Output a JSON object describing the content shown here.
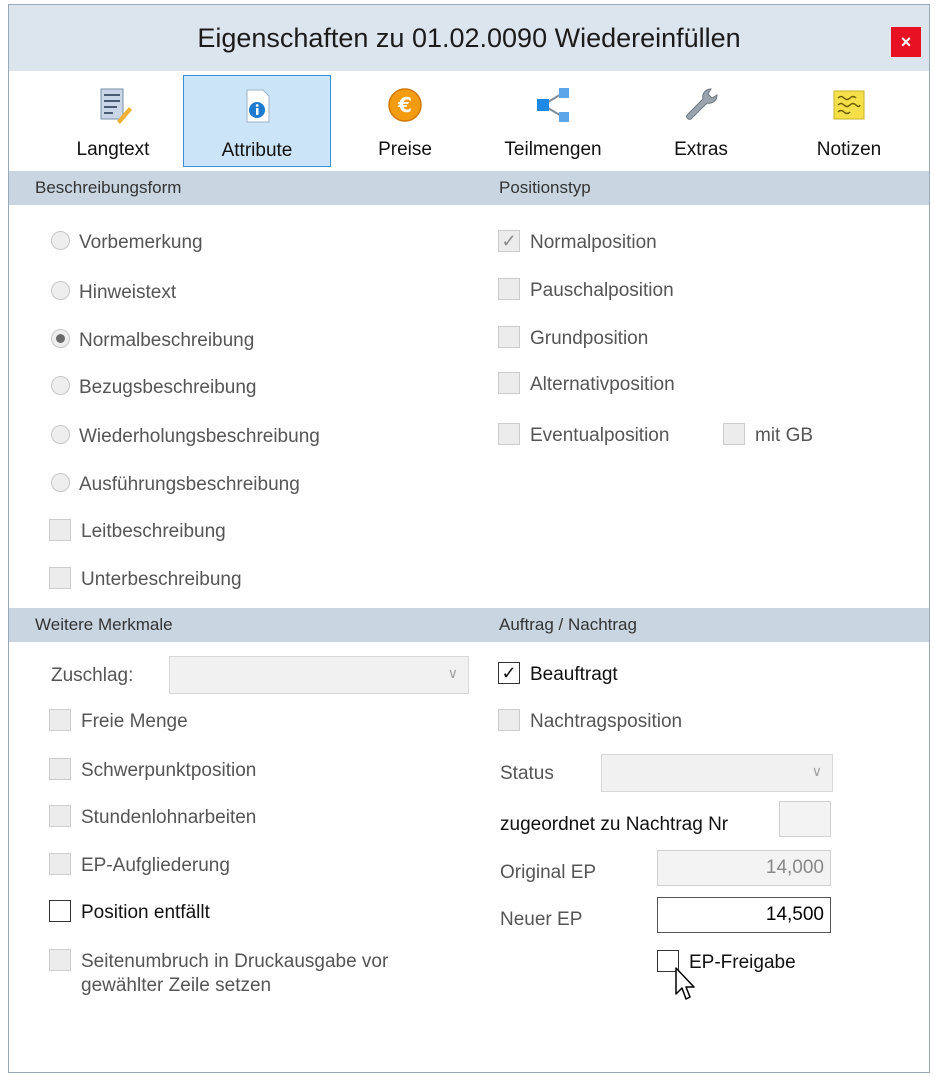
{
  "window": {
    "title": "Eigenschaften zu 01.02.0090 Wiedereinfüllen",
    "close_label": "×"
  },
  "toolbar": {
    "langtext": "Langtext",
    "attribute": "Attribute",
    "preise": "Preise",
    "teilmengen": "Teilmengen",
    "extras": "Extras",
    "notizen": "Notizen"
  },
  "sections": {
    "beschreibungsform": "Beschreibungsform",
    "positionstyp": "Positionstyp",
    "weitere_merkmale": "Weitere Merkmale",
    "auftrag_nachtrag": "Auftrag / Nachtrag"
  },
  "beschreibungsform": {
    "vorbemerkung": "Vorbemerkung",
    "hinweistext": "Hinweistext",
    "normalbeschreibung": "Normalbeschreibung",
    "bezugsbeschreibung": "Bezugsbeschreibung",
    "wiederholungsbeschreibung": "Wiederholungsbeschreibung",
    "ausfuehrungsbeschreibung": "Ausführungsbeschreibung",
    "leitbeschreibung": "Leitbeschreibung",
    "unterbeschreibung": "Unterbeschreibung",
    "selected": "Normalbeschreibung"
  },
  "positionstyp": {
    "normalposition": "Normalposition",
    "pauschalposition": "Pauschalposition",
    "grundposition": "Grundposition",
    "alternativposition": "Alternativposition",
    "eventualposition": "Eventualposition",
    "mit_gb": "mit GB"
  },
  "weitere": {
    "zuschlag_label": "Zuschlag:",
    "zuschlag_value": "",
    "freie_menge": "Freie Menge",
    "schwerpunktposition": "Schwerpunktposition",
    "stundenlohnarbeiten": "Stundenlohnarbeiten",
    "ep_aufgliederung": "EP-Aufgliederung",
    "position_entfaellt": "Position entfällt",
    "seitenumbruch_line1": "Seitenumbruch in Druckausgabe vor",
    "seitenumbruch_line2": "gewählter Zeile setzen"
  },
  "auftrag": {
    "beauftragt": "Beauftragt",
    "beauftragt_checked": true,
    "nachtragsposition": "Nachtragsposition",
    "status_label": "Status",
    "status_value": "",
    "zugeordnet_label": "zugeordnet zu Nachtrag Nr",
    "zugeordnet_value": "",
    "original_ep_label": "Original EP",
    "original_ep_value": "14,000",
    "neuer_ep_label": "Neuer EP",
    "neuer_ep_value": "14,500",
    "ep_freigabe": "EP-Freigabe"
  },
  "checkmark": "✓"
}
